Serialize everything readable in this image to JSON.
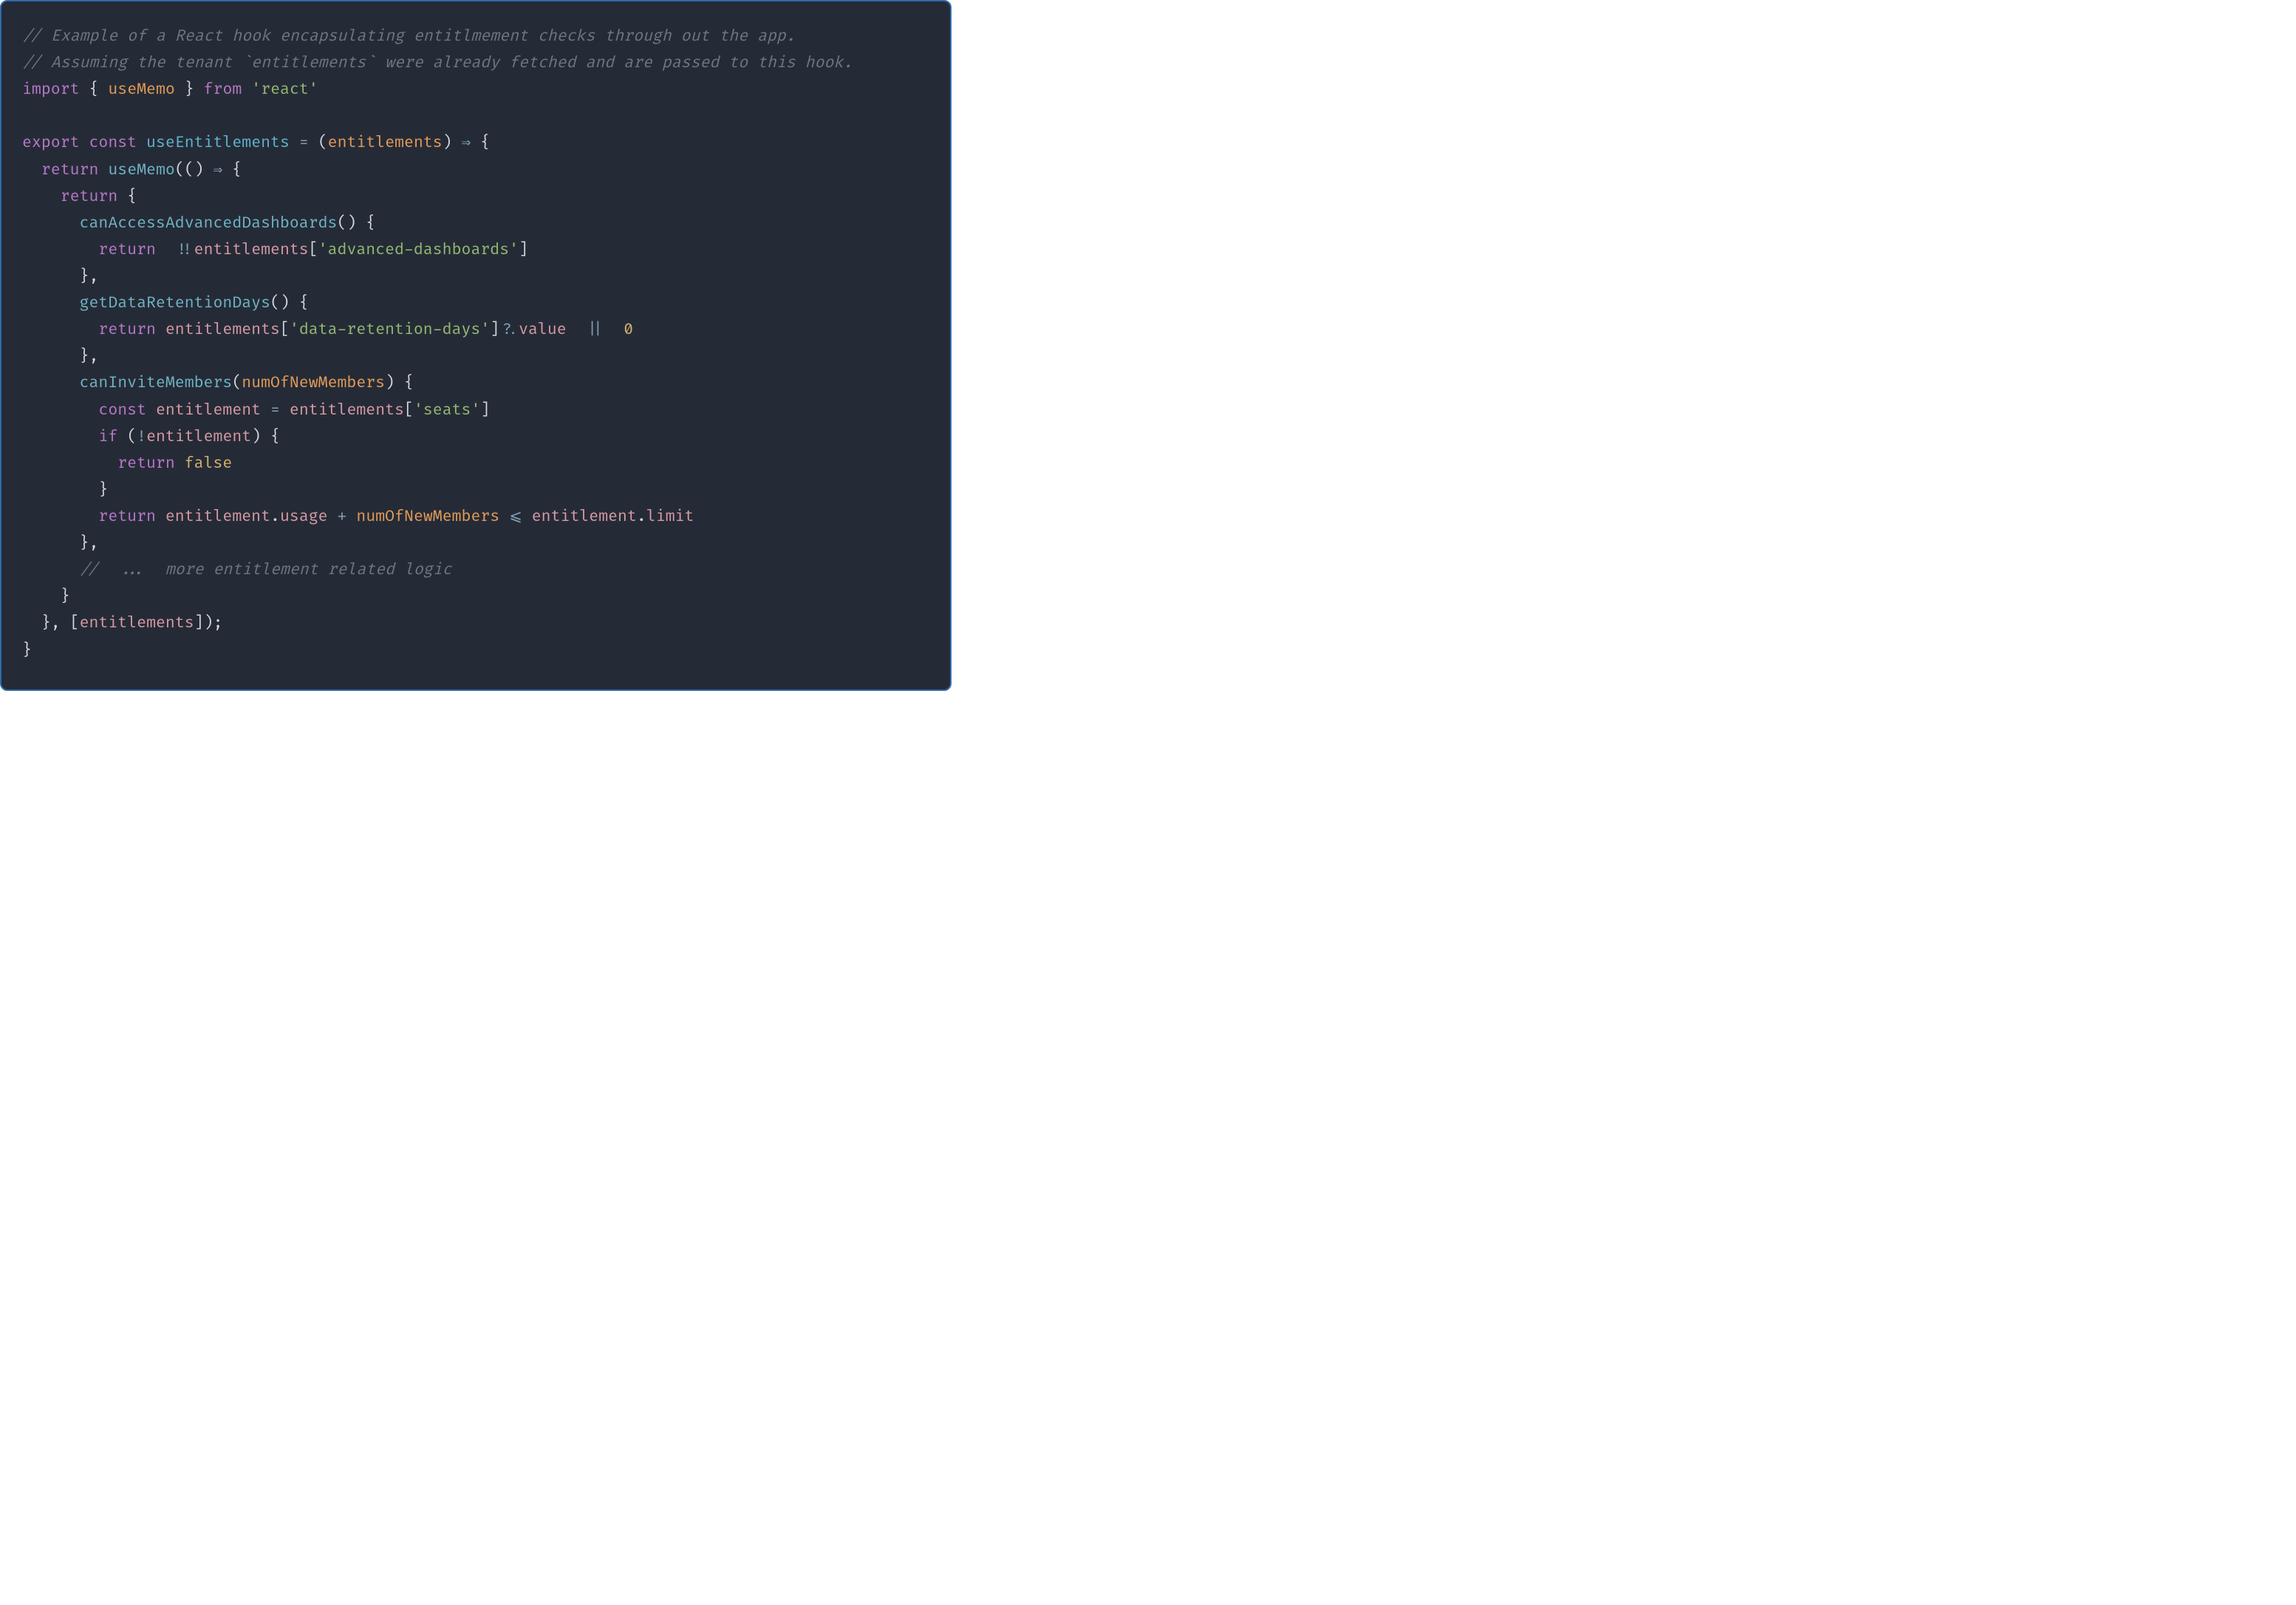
{
  "code": {
    "l1": {
      "comment": "// Example of a React hook encapsulating entitlmement checks through out the app."
    },
    "l2": {
      "comment": "// Assuming the tenant `entitlements` were already fetched and are passed to this hook."
    },
    "l3": {
      "kw_import": "import",
      "brace_open": "{",
      "name_useMemo": "useMemo",
      "brace_close": "}",
      "kw_from": "from",
      "str_react": "'react'"
    },
    "l5": {
      "kw_export": "export",
      "kw_const": "const",
      "fn_useEntitlements": "useEntitlements",
      "op_assign": "=",
      "paren_open": "(",
      "param_entitlements": "entitlements",
      "paren_close": ")",
      "op_arrow": "⇒",
      "brace_open": "{"
    },
    "l6": {
      "indent": "  ",
      "kw_return": "return",
      "fn_useMemo": "useMemo",
      "paren_open": "(",
      "paren_open2": "(",
      "paren_close2": ")",
      "op_arrow": "⇒",
      "brace_open": "{"
    },
    "l7": {
      "indent": "    ",
      "kw_return": "return",
      "brace_open": "{"
    },
    "l8": {
      "indent": "      ",
      "method": "canAccessAdvancedDashboards",
      "parens": "()",
      "brace_open": "{"
    },
    "l9": {
      "indent": "        ",
      "kw_return": "return",
      "sp": "  ",
      "op_notnot": "!!",
      "var_entitlements": "entitlements",
      "bracket_open": "[",
      "str_key": "'advanced-dashboards'",
      "bracket_close": "]"
    },
    "l10": {
      "indent": "      ",
      "brace_close": "}",
      "comma": ","
    },
    "l11": {
      "indent": "      ",
      "method": "getDataRetentionDays",
      "parens": "()",
      "brace_open": "{"
    },
    "l12": {
      "indent": "        ",
      "kw_return": "return",
      "var_entitlements": "entitlements",
      "bracket_open": "[",
      "str_key": "'data-retention-days'",
      "bracket_close": "]",
      "op_optchain": "?.",
      "prop_value": "value",
      "sp": "  ",
      "op_or": "||",
      "sp2": "  ",
      "num_zero": "0"
    },
    "l13": {
      "indent": "      ",
      "brace_close": "}",
      "comma": ","
    },
    "l14": {
      "indent": "      ",
      "method": "canInviteMembers",
      "paren_open": "(",
      "param": "numOfNewMembers",
      "paren_close": ")",
      "brace_open": "{"
    },
    "l15": {
      "indent": "        ",
      "kw_const": "const",
      "var_entitlement": "entitlement",
      "op_assign": "=",
      "var_entitlements": "entitlements",
      "bracket_open": "[",
      "str_key": "'seats'",
      "bracket_close": "]"
    },
    "l16": {
      "indent": "        ",
      "kw_if": "if",
      "paren_open": "(",
      "op_not": "!",
      "var_entitlement": "entitlement",
      "paren_close": ")",
      "brace_open": "{"
    },
    "l17": {
      "indent": "          ",
      "kw_return": "return",
      "bool_false": "false"
    },
    "l18": {
      "indent": "        ",
      "brace_close": "}"
    },
    "l19": {
      "indent": "        ",
      "kw_return": "return",
      "var_entitlement": "entitlement",
      "dot1": ".",
      "prop_usage": "usage",
      "op_plus": "+",
      "var_numOfNewMembers": "numOfNewMembers",
      "op_lte": "⩽",
      "var_entitlement2": "entitlement",
      "dot2": ".",
      "prop_limit": "limit"
    },
    "l20": {
      "indent": "      ",
      "brace_close": "}",
      "comma": ","
    },
    "l21": {
      "indent": "      ",
      "comment": "//  ...  more entitlement related logic"
    },
    "l22": {
      "indent": "    ",
      "brace_close": "}"
    },
    "l23": {
      "indent": "  ",
      "brace_close": "}",
      "comma": ",",
      "bracket_open": "[",
      "var_entitlements": "entitlements",
      "bracket_close": "]",
      "paren_close": ")",
      "semi": ";"
    },
    "l24": {
      "brace_close": "}"
    }
  }
}
